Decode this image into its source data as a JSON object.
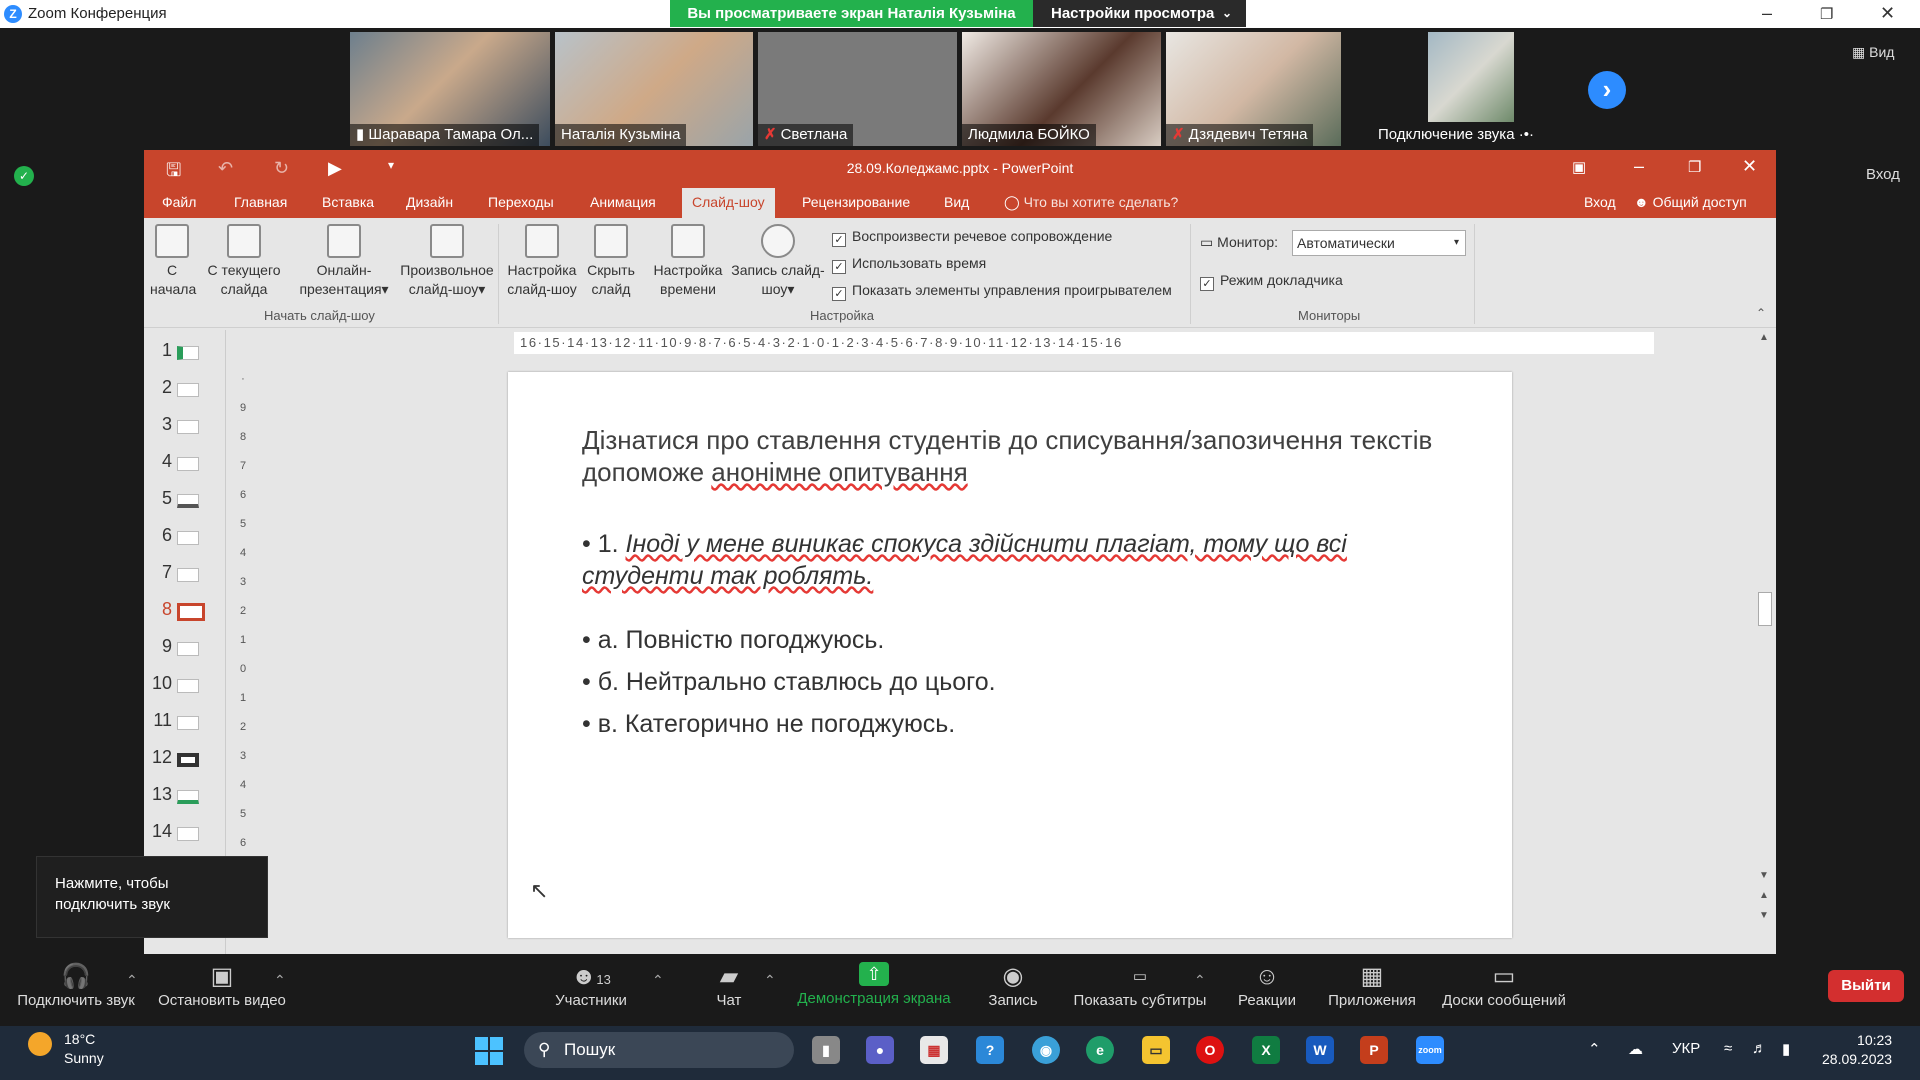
{
  "zoom": {
    "window_title": "Zoom Конференция",
    "share_banner": "Вы просматриваете экран Наталія Кузьміна",
    "view_options": "Настройки просмотра",
    "view_button": "Вид",
    "enter_button": "Вход",
    "participants": [
      {
        "name": "Шаравара Тамара Ол...",
        "muted": false
      },
      {
        "name": "Наталія Кузьміна",
        "muted": false
      },
      {
        "name": "Светлана",
        "muted": true
      },
      {
        "name": "Людмила БОЙКО",
        "muted": false
      },
      {
        "name": "Дзядевич Тетяна",
        "muted": true
      },
      {
        "name": "Подключение звука",
        "muted": false
      }
    ],
    "audio_tooltip": "Нажмите, чтобы подключить звук",
    "toolbar": {
      "audio": "Подключить звук",
      "video": "Остановить видео",
      "participants": "Участники",
      "participants_count": "13",
      "chat": "Чат",
      "share": "Демонстрация экрана",
      "record": "Запись",
      "captions": "Показать субтитры",
      "reactions": "Реакции",
      "apps": "Приложения",
      "whiteboards": "Доски сообщений",
      "leave": "Выйти"
    }
  },
  "powerpoint": {
    "title": "28.09.Коледжамс.pptx - PowerPoint",
    "tabs": [
      "Файл",
      "Главная",
      "Вставка",
      "Дизайн",
      "Переходы",
      "Анимация",
      "Слайд-шоу",
      "Рецензирование",
      "Вид"
    ],
    "active_tab": "Слайд-шоу",
    "tell_me": "Что вы хотите сделать?",
    "signin": "Вход",
    "share": "Общий доступ",
    "ribbon": {
      "from_start": [
        "С",
        "начала"
      ],
      "from_current": [
        "С текущего",
        "слайда"
      ],
      "online": [
        "Онлайн-",
        "презентация"
      ],
      "custom": [
        "Произвольное",
        "слайд-шоу"
      ],
      "group1": "Начать слайд-шоу",
      "setup": [
        "Настройка",
        "слайд-шоу"
      ],
      "hide": [
        "Скрыть",
        "слайд"
      ],
      "rehearse": [
        "Настройка",
        "времени"
      ],
      "record": [
        "Запись слайд-",
        "шоу"
      ],
      "chk_narration": "Воспроизвести речевое сопровождение",
      "chk_timings": "Использовать время",
      "chk_controls": "Показать элементы управления проигрывателем",
      "group2": "Настройка",
      "monitor_label": "Монитор:",
      "monitor_value": "Автоматически",
      "presenter_view": "Режим докладчика",
      "group3": "Мониторы"
    },
    "thumbnails": [
      "1",
      "2",
      "3",
      "4",
      "5",
      "6",
      "7",
      "8",
      "9",
      "10",
      "11",
      "12",
      "13",
      "14"
    ],
    "selected_slide": "8",
    "hruler": "16·15·14·13·12·11·10·9·8·7·6·5·4·3·2·1·0·1·2·3·4·5·6·7·8·9·10·11·12·13·14·15·16",
    "slide": {
      "title_a": "Дізнатися про ставлення студентів до списування/запозичення текстів допоможе ",
      "title_b": "анонімне опитування",
      "question_num": "• 1. ",
      "question": "Іноді у мене виникає спокуса здійснити плагіат, тому що всі студенти так роблять.",
      "options": [
        "• а. Повністю погоджуюсь.",
        "• б. Нейтрально ставлюсь до цього.",
        "• в. Категорично не погоджуюсь."
      ]
    }
  },
  "taskbar": {
    "temp": "18°C",
    "weather": "Sunny",
    "search": "Пошук",
    "lang": "УКР",
    "time": "10:23",
    "date": "28.09.2023"
  }
}
